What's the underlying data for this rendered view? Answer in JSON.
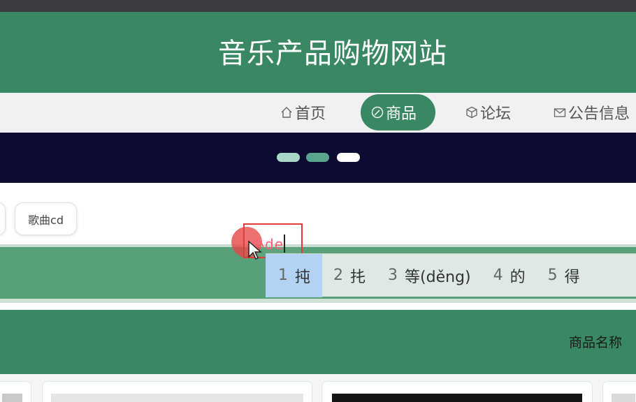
{
  "site": {
    "title": "音乐产品购物网站"
  },
  "nav": {
    "items": [
      {
        "label": "首页",
        "icon": "home-icon"
      },
      {
        "label": "商品",
        "icon": "dashboard-icon",
        "active": true
      },
      {
        "label": "论坛",
        "icon": "box-icon"
      },
      {
        "label": "公告信息",
        "icon": "mail-icon"
      }
    ],
    "active_color": "#3a8763"
  },
  "banner": {
    "dots": 3,
    "active_dot": 3
  },
  "categories": {
    "chips": [
      "歌曲cd"
    ]
  },
  "search": {
    "typed_text": "小de"
  },
  "ime": {
    "candidates": [
      {
        "num": "1",
        "text": "扽"
      },
      {
        "num": "2",
        "text": "扥"
      },
      {
        "num": "3",
        "text": "等(děng)"
      },
      {
        "num": "4",
        "text": "的"
      },
      {
        "num": "5",
        "text": "得"
      }
    ],
    "selected": 1
  },
  "list_header": {
    "sort_label": "商品名称"
  },
  "colors": {
    "brand": "#3a8763",
    "band": "#58a077",
    "banner": "#0c0c32"
  }
}
